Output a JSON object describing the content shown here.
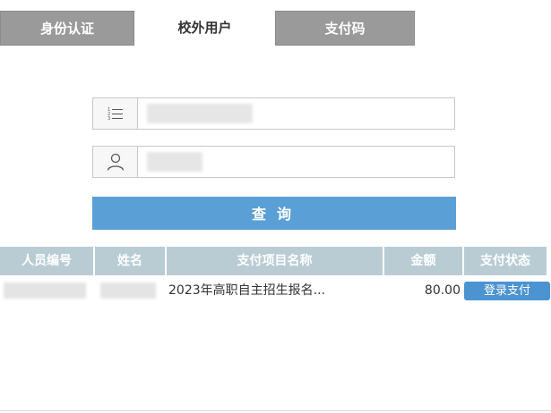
{
  "tabs": [
    {
      "label": "身份认证",
      "active": false
    },
    {
      "label": "校外用户",
      "active": true
    },
    {
      "label": "支付码",
      "active": false
    }
  ],
  "form": {
    "id_field": {
      "icon": "list-icon",
      "value": ""
    },
    "name_field": {
      "icon": "user-icon",
      "value": ""
    },
    "query_label": "查询"
  },
  "table": {
    "headers": [
      "人员编号",
      "姓名",
      "支付项目名称",
      "金额",
      "支付状态"
    ],
    "rows": [
      {
        "id": "",
        "name": "",
        "item": "2023年高职自主招生报名...",
        "amount": "80.00",
        "action": "登录支付"
      }
    ]
  },
  "colors": {
    "tab_inactive": "#9a9a9a",
    "button": "#5a9fd6",
    "header": "#b9ccd4",
    "pay_button": "#4b93d1"
  }
}
